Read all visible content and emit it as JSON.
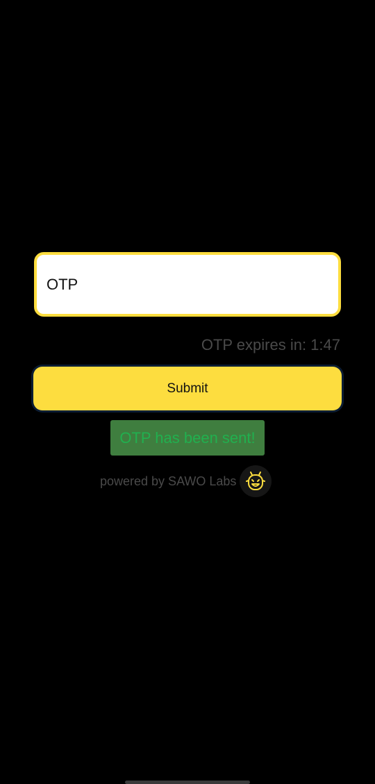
{
  "otp_field": {
    "placeholder": "OTP",
    "value": ""
  },
  "timer": {
    "text": "OTP expires in: 1:47"
  },
  "submit": {
    "label": "Submit"
  },
  "toast": {
    "message": "OTP has been sent!"
  },
  "footer": {
    "powered_by": "powered by SAWO Labs",
    "logo_icon": "sawo-bee-icon"
  },
  "colors": {
    "accent": "#fddd3f",
    "background": "#000000",
    "toast_bg": "#3f7e3f",
    "toast_text": "#21b04f",
    "muted_text": "#4a4a4a"
  }
}
